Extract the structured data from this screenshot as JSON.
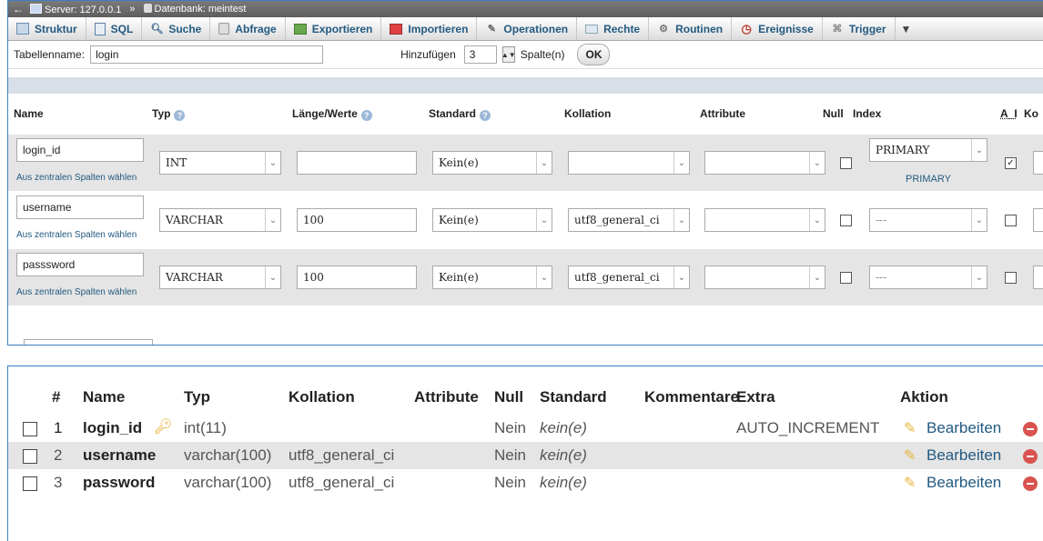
{
  "breadcrumb": {
    "server": "Server: 127.0.0.1",
    "separator": "»",
    "database": "Datenbank: meintest"
  },
  "tabs": [
    {
      "label": "Struktur",
      "icon": "structure-icon"
    },
    {
      "label": "SQL",
      "icon": "sql-icon"
    },
    {
      "label": "Suche",
      "icon": "search-icon"
    },
    {
      "label": "Abfrage",
      "icon": "query-icon"
    },
    {
      "label": "Exportieren",
      "icon": "export-icon"
    },
    {
      "label": "Importieren",
      "icon": "import-icon"
    },
    {
      "label": "Operationen",
      "icon": "wrench-icon"
    },
    {
      "label": "Rechte",
      "icon": "privileges-icon"
    },
    {
      "label": "Routinen",
      "icon": "routines-icon"
    },
    {
      "label": "Ereignisse",
      "icon": "clock-icon"
    },
    {
      "label": "Trigger",
      "icon": "trigger-icon"
    }
  ],
  "tablename": {
    "label": "Tabellenname:",
    "value": "login",
    "add_label": "Hinzufügen",
    "add_count": "3",
    "columns_label": "Spalte(n)",
    "ok_label": "OK"
  },
  "edit_headers": {
    "name": "Name",
    "type": "Typ",
    "length": "Länge/Werte",
    "default": "Standard",
    "collation": "Kollation",
    "attribute": "Attribute",
    "null": "Null",
    "index": "Index",
    "ai": "A_I",
    "comment": "Ko"
  },
  "central_link": "Aus zentralen Spalten wählen",
  "edit_rows": [
    {
      "name": "login_id",
      "type": "INT",
      "length": "",
      "default": "Kein(e)",
      "collation": "",
      "attribute": "",
      "null": false,
      "index": "PRIMARY",
      "index_sub": "PRIMARY",
      "ai": true
    },
    {
      "name": "username",
      "type": "VARCHAR",
      "length": "100",
      "default": "Kein(e)",
      "collation": "utf8_general_ci",
      "attribute": "",
      "null": false,
      "index": "---",
      "index_sub": "",
      "ai": false
    },
    {
      "name": "passsword",
      "type": "VARCHAR",
      "length": "100",
      "default": "Kein(e)",
      "collation": "utf8_general_ci",
      "attribute": "",
      "null": false,
      "index": "---",
      "index_sub": "",
      "ai": false
    }
  ],
  "structure_headers": {
    "num": "#",
    "name": "Name",
    "type": "Typ",
    "collation": "Kollation",
    "attributes": "Attribute",
    "null": "Null",
    "default": "Standard",
    "comments": "Kommentare",
    "extra": "Extra",
    "action": "Aktion"
  },
  "structure_rows": [
    {
      "num": "1",
      "name": "login_id",
      "type": "int(11)",
      "collation": "",
      "null": "Nein",
      "default": "kein(e)",
      "extra": "AUTO_INCREMENT",
      "edit": "Bearbeiten",
      "primary_key": true
    },
    {
      "num": "2",
      "name": "username",
      "type": "varchar(100)",
      "collation": "utf8_general_ci",
      "null": "Nein",
      "default": "kein(e)",
      "extra": "",
      "edit": "Bearbeiten",
      "primary_key": false
    },
    {
      "num": "3",
      "name": "password",
      "type": "varchar(100)",
      "collation": "utf8_general_ci",
      "null": "Nein",
      "default": "kein(e)",
      "extra": "",
      "edit": "Bearbeiten",
      "primary_key": false
    }
  ]
}
